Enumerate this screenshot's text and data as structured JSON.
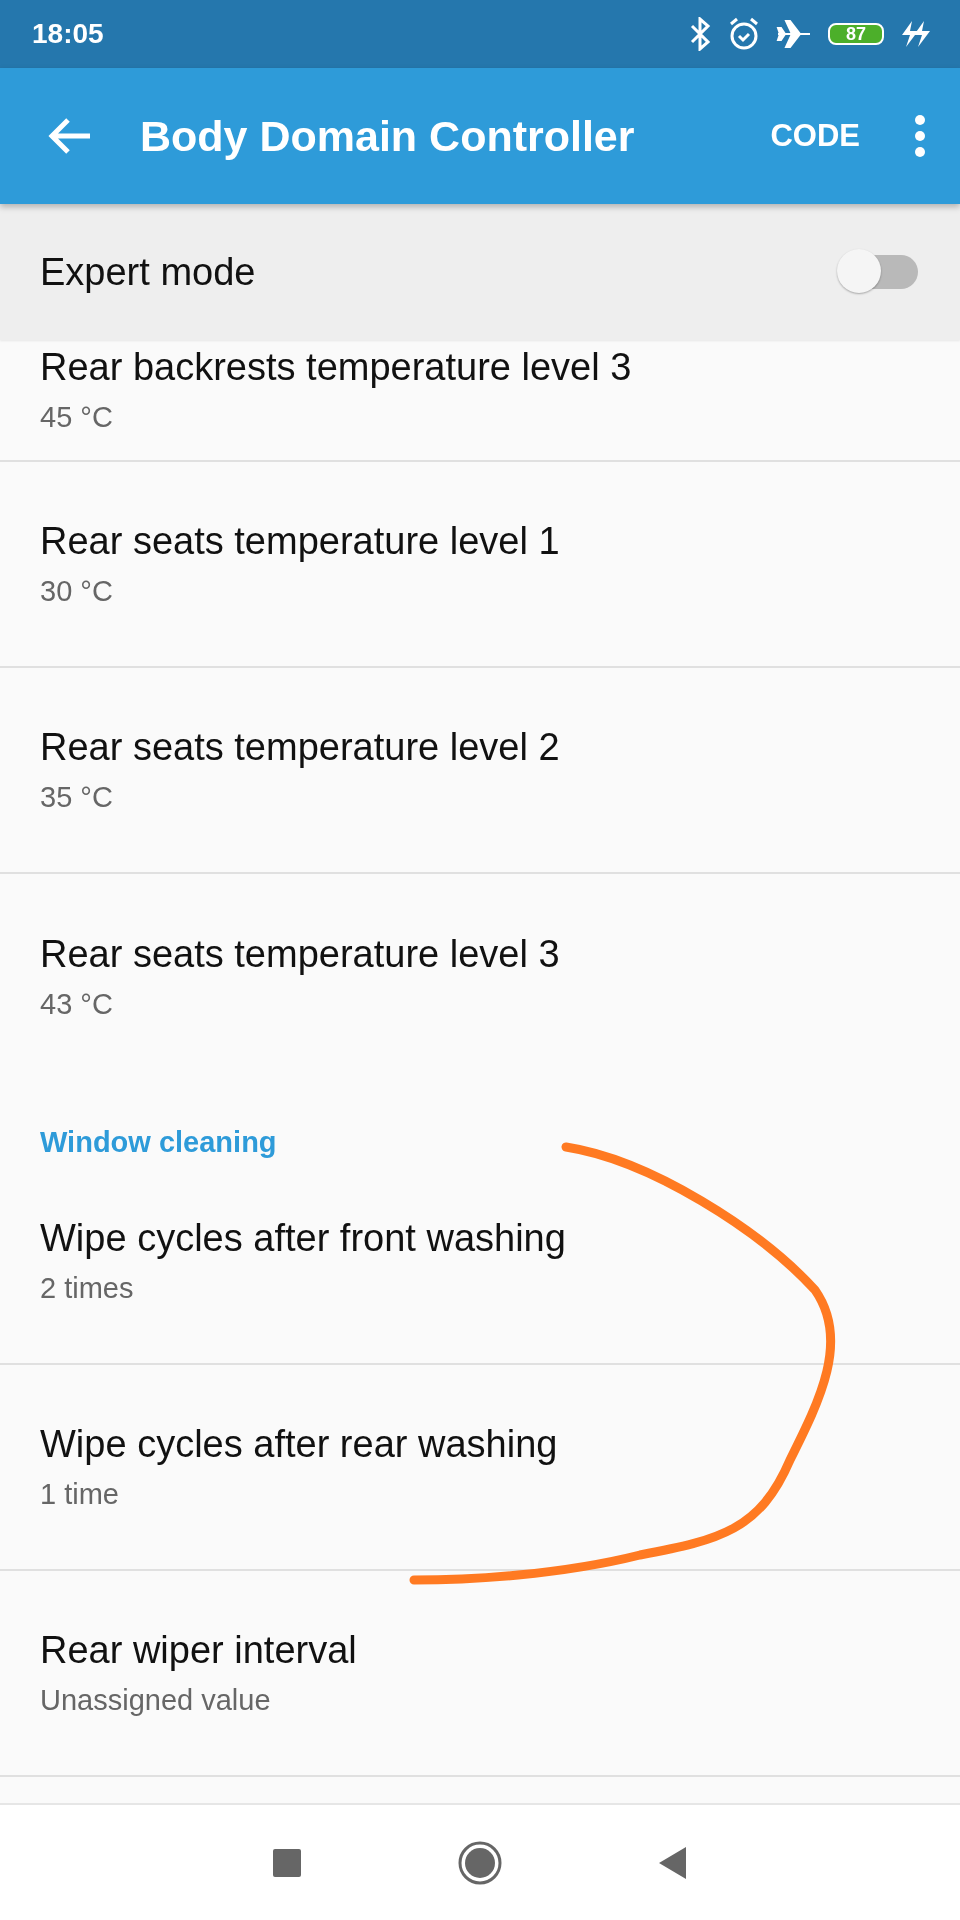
{
  "status_bar": {
    "time": "18:05",
    "battery": "87"
  },
  "app_bar": {
    "title": "Body Domain Controller",
    "action": "CODE"
  },
  "expert_mode": {
    "label": "Expert mode",
    "on": false
  },
  "sections": [
    {
      "items": [
        {
          "title": "Rear backrests temperature level 3",
          "value": "45 °C"
        },
        {
          "title": "Rear seats temperature level 1",
          "value": "30 °C"
        },
        {
          "title": "Rear seats temperature level 2",
          "value": "35 °C"
        },
        {
          "title": "Rear seats temperature level 3",
          "value": "43 °C"
        }
      ]
    },
    {
      "header": "Window cleaning",
      "items": [
        {
          "title": "Wipe cycles after front washing",
          "value": "2 times"
        },
        {
          "title": "Wipe cycles after rear washing",
          "value": "1 time"
        },
        {
          "title": "Rear wiper interval",
          "value": "Unassigned value"
        }
      ]
    }
  ]
}
